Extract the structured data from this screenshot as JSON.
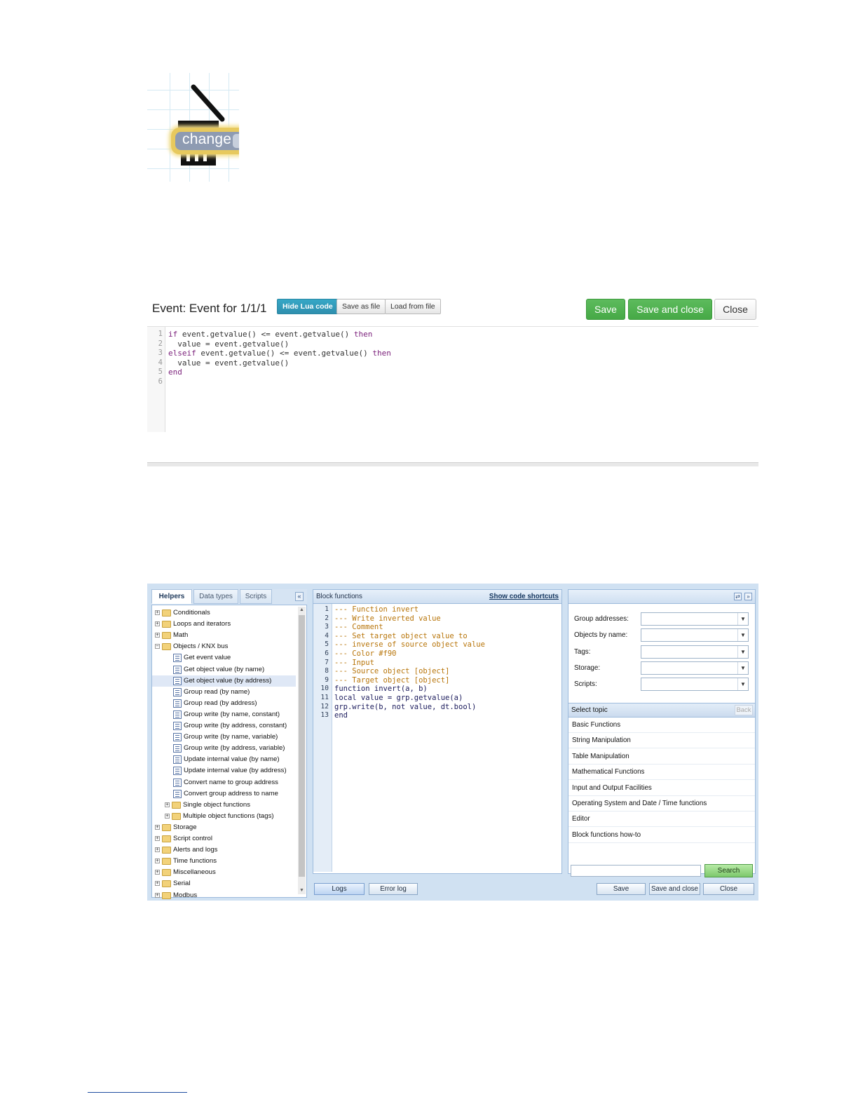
{
  "block": {
    "label": "change"
  },
  "event_editor": {
    "title": "Event: Event for 1/1/1",
    "buttons": {
      "hide_lua": "Hide Lua code",
      "save_as_file": "Save as file",
      "load_from_file": "Load from file",
      "save": "Save",
      "save_and_close": "Save and close",
      "close": "Close"
    },
    "code": [
      {
        "n": "1",
        "parts": [
          [
            "kw",
            "if"
          ],
          [
            "",
            "event.getvalue() <= event.getvalue() "
          ],
          [
            "kw",
            "then"
          ]
        ]
      },
      {
        "n": "2",
        "parts": [
          [
            "",
            "  value = event.getvalue()"
          ]
        ]
      },
      {
        "n": "3",
        "parts": [
          [
            "kw",
            "elseif"
          ],
          [
            "",
            "event.getvalue() <= event.getvalue() "
          ],
          [
            "kw",
            "then"
          ]
        ]
      },
      {
        "n": "4",
        "parts": [
          [
            "",
            "  value = event.getvalue()"
          ]
        ]
      },
      {
        "n": "5",
        "parts": [
          [
            "kw",
            "end"
          ]
        ]
      },
      {
        "n": "6",
        "parts": [
          [
            "",
            ""
          ]
        ]
      }
    ]
  },
  "script_editor": {
    "tabs": [
      "Helpers",
      "Data types",
      "Scripts"
    ],
    "collapse_symbol": "«",
    "tree": [
      {
        "label": "Conditionals",
        "type": "folder",
        "level": 0,
        "exp": "+"
      },
      {
        "label": "Loops and iterators",
        "type": "folder",
        "level": 0,
        "exp": "+"
      },
      {
        "label": "Math",
        "type": "folder",
        "level": 0,
        "exp": "+"
      },
      {
        "label": "Objects / KNX bus",
        "type": "folder",
        "level": 0,
        "exp": "−"
      },
      {
        "label": "Get event value",
        "type": "file",
        "level": 1
      },
      {
        "label": "Get object value (by name)",
        "type": "file",
        "level": 1
      },
      {
        "label": "Get object value (by address)",
        "type": "file",
        "level": 1,
        "selected": true
      },
      {
        "label": "Group read (by name)",
        "type": "file",
        "level": 1
      },
      {
        "label": "Group read (by address)",
        "type": "file",
        "level": 1
      },
      {
        "label": "Group write (by name, constant)",
        "type": "file",
        "level": 1
      },
      {
        "label": "Group write (by address, constant)",
        "type": "file",
        "level": 1
      },
      {
        "label": "Group write (by name, variable)",
        "type": "file",
        "level": 1
      },
      {
        "label": "Group write (by address, variable)",
        "type": "file",
        "level": 1
      },
      {
        "label": "Update internal value (by name)",
        "type": "file",
        "level": 1
      },
      {
        "label": "Update internal value (by address)",
        "type": "file",
        "level": 1
      },
      {
        "label": "Convert name to group address",
        "type": "file",
        "level": 1
      },
      {
        "label": "Convert group address to name",
        "type": "file",
        "level": 1
      },
      {
        "label": "Single object functions",
        "type": "folder",
        "level": 1,
        "exp": "+"
      },
      {
        "label": "Multiple object functions (tags)",
        "type": "folder",
        "level": 1,
        "exp": "+"
      },
      {
        "label": "Storage",
        "type": "folder",
        "level": 0,
        "exp": "+"
      },
      {
        "label": "Script control",
        "type": "folder",
        "level": 0,
        "exp": "+"
      },
      {
        "label": "Alerts and logs",
        "type": "folder",
        "level": 0,
        "exp": "+"
      },
      {
        "label": "Time functions",
        "type": "folder",
        "level": 0,
        "exp": "+"
      },
      {
        "label": "Miscellaneous",
        "type": "folder",
        "level": 0,
        "exp": "+"
      },
      {
        "label": "Serial",
        "type": "folder",
        "level": 0,
        "exp": "+"
      },
      {
        "label": "Modbus",
        "type": "folder",
        "level": 0,
        "exp": "+"
      }
    ],
    "middle": {
      "title": "Block functions",
      "shortcuts_link": "Show code shortcuts",
      "code": [
        {
          "n": "1",
          "parts": [
            [
              "cmt",
              "--- Function invert"
            ]
          ]
        },
        {
          "n": "2",
          "parts": [
            [
              "cmt",
              "--- Write inverted value"
            ]
          ]
        },
        {
          "n": "3",
          "parts": [
            [
              "cmt",
              "--- Comment"
            ]
          ]
        },
        {
          "n": "4",
          "parts": [
            [
              "cmt",
              "--- Set target object value to"
            ]
          ]
        },
        {
          "n": "5",
          "parts": [
            [
              "cmt",
              "--- inverse of source object value"
            ]
          ]
        },
        {
          "n": "6",
          "parts": [
            [
              "cmt",
              "--- Color #f90"
            ]
          ]
        },
        {
          "n": "7",
          "parts": [
            [
              "cmt",
              "--- Input"
            ]
          ]
        },
        {
          "n": "8",
          "parts": [
            [
              "cmt",
              "--- Source object [object]"
            ]
          ]
        },
        {
          "n": "9",
          "parts": [
            [
              "cmt",
              "--- Target object [object]"
            ]
          ]
        },
        {
          "n": "10",
          "parts": [
            [
              "",
              "function invert(a, b)"
            ]
          ]
        },
        {
          "n": "11",
          "parts": [
            [
              "",
              "local value = grp.getvalue(a)"
            ]
          ]
        },
        {
          "n": "12",
          "parts": [
            [
              "",
              "grp.write(b, not value, dt.bool)"
            ]
          ]
        },
        {
          "n": "13",
          "parts": [
            [
              "",
              "end"
            ]
          ]
        }
      ]
    },
    "right": {
      "icons": [
        "⇄",
        "»"
      ],
      "fields": [
        "Group addresses:",
        "Objects by name:",
        "Tags:",
        "Storage:",
        "Scripts:"
      ],
      "dropdown_symbol": "▼",
      "topic_title": "Select topic",
      "back": "Back",
      "topics": [
        "Basic Functions",
        "String Manipulation",
        "Table Manipulation",
        "Mathematical Functions",
        "Input and Output Facilities",
        "Operating System and Date / Time functions",
        "Editor",
        "Block functions how-to"
      ],
      "search_placeholder": "",
      "search": "Search"
    },
    "bottom": {
      "logs": "Logs",
      "error_log": "Error log",
      "save": "Save",
      "save_and_close": "Save and close",
      "close": "Close"
    }
  }
}
